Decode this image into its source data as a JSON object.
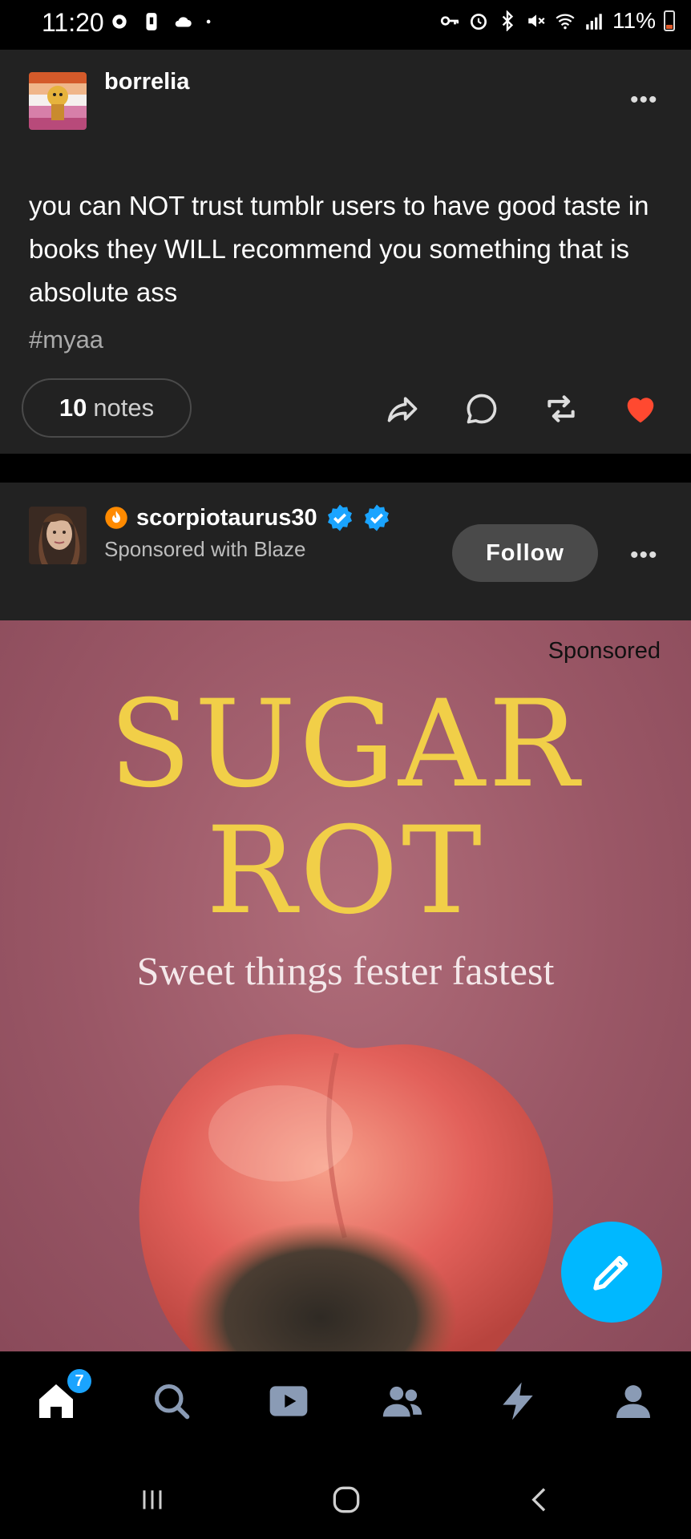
{
  "status_bar": {
    "time": "11:20",
    "battery": "11%",
    "icons_left": [
      "settings-gear-icon",
      "sim-icon",
      "cloud-icon",
      "dot-icon"
    ],
    "icons_right": [
      "key-icon",
      "alarm-icon",
      "bluetooth-icon",
      "mute-icon",
      "wifi-icon",
      "signal-icon",
      "battery-icon"
    ]
  },
  "post1": {
    "blog_name": "borrelia",
    "text": "you can NOT trust tumblr users to have good taste in books they WILL recommend you something that is absolute ass",
    "tag": "#myaa",
    "notes_count": "10",
    "notes_label": "notes",
    "liked": true
  },
  "post2": {
    "blog_name": "scorpiotaurus30",
    "subtitle": "Sponsored with Blaze",
    "follow_label": "Follow",
    "sponsored_label": "Sponsored",
    "cover": {
      "title_line1": "SUGAR",
      "title_line2": "ROT",
      "tagline": "Sweet things fester fastest"
    }
  },
  "tab_bar": {
    "home_badge": "7",
    "tabs": [
      "home-icon",
      "search-icon",
      "video-icon",
      "community-icon",
      "activity-icon",
      "account-icon"
    ]
  },
  "colors": {
    "accent": "#00b8ff",
    "like": "#ff4930",
    "cover_title": "#f1cf48",
    "card_bg": "#222222"
  }
}
